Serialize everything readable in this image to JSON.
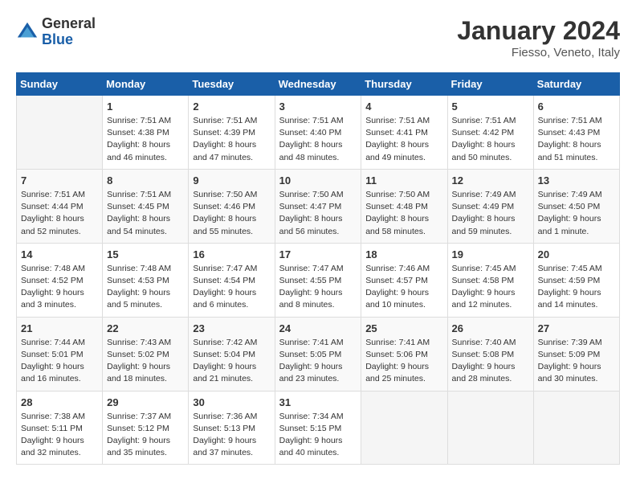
{
  "logo": {
    "general": "General",
    "blue": "Blue"
  },
  "title": "January 2024",
  "subtitle": "Fiesso, Veneto, Italy",
  "days_header": [
    "Sunday",
    "Monday",
    "Tuesday",
    "Wednesday",
    "Thursday",
    "Friday",
    "Saturday"
  ],
  "weeks": [
    [
      {
        "num": "",
        "info": ""
      },
      {
        "num": "1",
        "info": "Sunrise: 7:51 AM\nSunset: 4:38 PM\nDaylight: 8 hours\nand 46 minutes."
      },
      {
        "num": "2",
        "info": "Sunrise: 7:51 AM\nSunset: 4:39 PM\nDaylight: 8 hours\nand 47 minutes."
      },
      {
        "num": "3",
        "info": "Sunrise: 7:51 AM\nSunset: 4:40 PM\nDaylight: 8 hours\nand 48 minutes."
      },
      {
        "num": "4",
        "info": "Sunrise: 7:51 AM\nSunset: 4:41 PM\nDaylight: 8 hours\nand 49 minutes."
      },
      {
        "num": "5",
        "info": "Sunrise: 7:51 AM\nSunset: 4:42 PM\nDaylight: 8 hours\nand 50 minutes."
      },
      {
        "num": "6",
        "info": "Sunrise: 7:51 AM\nSunset: 4:43 PM\nDaylight: 8 hours\nand 51 minutes."
      }
    ],
    [
      {
        "num": "7",
        "info": "Sunrise: 7:51 AM\nSunset: 4:44 PM\nDaylight: 8 hours\nand 52 minutes."
      },
      {
        "num": "8",
        "info": "Sunrise: 7:51 AM\nSunset: 4:45 PM\nDaylight: 8 hours\nand 54 minutes."
      },
      {
        "num": "9",
        "info": "Sunrise: 7:50 AM\nSunset: 4:46 PM\nDaylight: 8 hours\nand 55 minutes."
      },
      {
        "num": "10",
        "info": "Sunrise: 7:50 AM\nSunset: 4:47 PM\nDaylight: 8 hours\nand 56 minutes."
      },
      {
        "num": "11",
        "info": "Sunrise: 7:50 AM\nSunset: 4:48 PM\nDaylight: 8 hours\nand 58 minutes."
      },
      {
        "num": "12",
        "info": "Sunrise: 7:49 AM\nSunset: 4:49 PM\nDaylight: 8 hours\nand 59 minutes."
      },
      {
        "num": "13",
        "info": "Sunrise: 7:49 AM\nSunset: 4:50 PM\nDaylight: 9 hours\nand 1 minute."
      }
    ],
    [
      {
        "num": "14",
        "info": "Sunrise: 7:48 AM\nSunset: 4:52 PM\nDaylight: 9 hours\nand 3 minutes."
      },
      {
        "num": "15",
        "info": "Sunrise: 7:48 AM\nSunset: 4:53 PM\nDaylight: 9 hours\nand 5 minutes."
      },
      {
        "num": "16",
        "info": "Sunrise: 7:47 AM\nSunset: 4:54 PM\nDaylight: 9 hours\nand 6 minutes."
      },
      {
        "num": "17",
        "info": "Sunrise: 7:47 AM\nSunset: 4:55 PM\nDaylight: 9 hours\nand 8 minutes."
      },
      {
        "num": "18",
        "info": "Sunrise: 7:46 AM\nSunset: 4:57 PM\nDaylight: 9 hours\nand 10 minutes."
      },
      {
        "num": "19",
        "info": "Sunrise: 7:45 AM\nSunset: 4:58 PM\nDaylight: 9 hours\nand 12 minutes."
      },
      {
        "num": "20",
        "info": "Sunrise: 7:45 AM\nSunset: 4:59 PM\nDaylight: 9 hours\nand 14 minutes."
      }
    ],
    [
      {
        "num": "21",
        "info": "Sunrise: 7:44 AM\nSunset: 5:01 PM\nDaylight: 9 hours\nand 16 minutes."
      },
      {
        "num": "22",
        "info": "Sunrise: 7:43 AM\nSunset: 5:02 PM\nDaylight: 9 hours\nand 18 minutes."
      },
      {
        "num": "23",
        "info": "Sunrise: 7:42 AM\nSunset: 5:04 PM\nDaylight: 9 hours\nand 21 minutes."
      },
      {
        "num": "24",
        "info": "Sunrise: 7:41 AM\nSunset: 5:05 PM\nDaylight: 9 hours\nand 23 minutes."
      },
      {
        "num": "25",
        "info": "Sunrise: 7:41 AM\nSunset: 5:06 PM\nDaylight: 9 hours\nand 25 minutes."
      },
      {
        "num": "26",
        "info": "Sunrise: 7:40 AM\nSunset: 5:08 PM\nDaylight: 9 hours\nand 28 minutes."
      },
      {
        "num": "27",
        "info": "Sunrise: 7:39 AM\nSunset: 5:09 PM\nDaylight: 9 hours\nand 30 minutes."
      }
    ],
    [
      {
        "num": "28",
        "info": "Sunrise: 7:38 AM\nSunset: 5:11 PM\nDaylight: 9 hours\nand 32 minutes."
      },
      {
        "num": "29",
        "info": "Sunrise: 7:37 AM\nSunset: 5:12 PM\nDaylight: 9 hours\nand 35 minutes."
      },
      {
        "num": "30",
        "info": "Sunrise: 7:36 AM\nSunset: 5:13 PM\nDaylight: 9 hours\nand 37 minutes."
      },
      {
        "num": "31",
        "info": "Sunrise: 7:34 AM\nSunset: 5:15 PM\nDaylight: 9 hours\nand 40 minutes."
      },
      {
        "num": "",
        "info": ""
      },
      {
        "num": "",
        "info": ""
      },
      {
        "num": "",
        "info": ""
      }
    ]
  ]
}
